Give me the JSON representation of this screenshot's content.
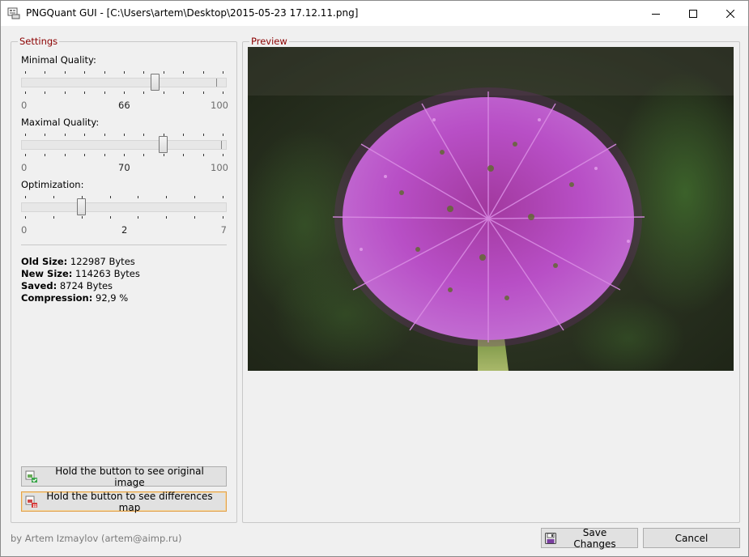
{
  "window": {
    "title": "PNGQuant GUI - [C:\\Users\\artem\\Desktop\\2015-05-23 17.12.11.png]",
    "controls": [
      "minimize-icon",
      "maximize-icon",
      "close-icon"
    ]
  },
  "settings": {
    "legend": "Settings",
    "min_quality": {
      "label": "Minimal Quality:",
      "min": "0",
      "value": "66",
      "max": "100",
      "fraction": 0.66
    },
    "max_quality": {
      "label": "Maximal Quality:",
      "min": "0",
      "value": "70",
      "max": "100",
      "fraction": 0.7
    },
    "optimization": {
      "label": "Optimization:",
      "min": "0",
      "value": "2",
      "max": "7",
      "fraction": 0.2857
    },
    "stats": {
      "old_size_label": "Old Size:",
      "old_size_value": " 122987 Bytes",
      "new_size_label": "New Size:",
      "new_size_value": " 114263 Bytes",
      "saved_label": "Saved:",
      "saved_value": " 8724 Bytes",
      "compression_label": "Compression:",
      "compression_value": " 92,9 %"
    },
    "original_button": "Hold the button to see original image",
    "diff_button": "Hold the button to see differences map"
  },
  "preview": {
    "legend": "Preview",
    "image": "allium-flower-photo"
  },
  "footer": {
    "author": "by Artem Izmaylov (artem@aimp.ru)",
    "save_label": "Save Changes",
    "cancel_label": "Cancel"
  },
  "colors": {
    "legend": "#8b0000",
    "focus_border": "#e2a04a",
    "flower": "#b04fc4",
    "background_green": "#2f4a22"
  }
}
